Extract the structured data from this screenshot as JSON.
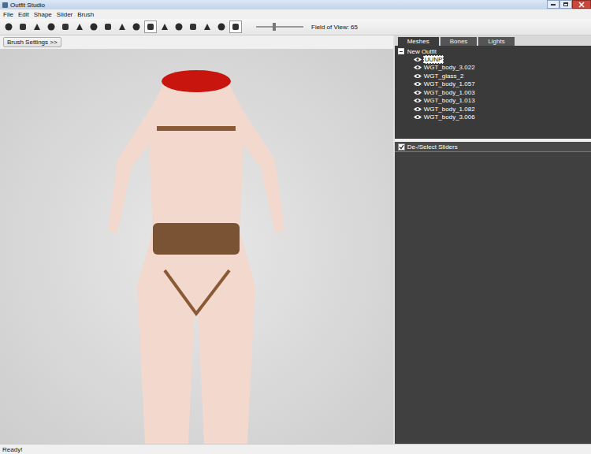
{
  "window": {
    "title": "Outfit Studio"
  },
  "menu": [
    "File",
    "Edit",
    "Shape",
    "Slider",
    "Brush"
  ],
  "tools": [
    {
      "selected": false
    },
    {
      "selected": false
    },
    {
      "selected": false
    },
    {
      "selected": false
    },
    {
      "selected": false
    },
    {
      "selected": false
    },
    {
      "selected": false
    },
    {
      "selected": false
    },
    {
      "selected": false
    },
    {
      "selected": false
    },
    {
      "selected": true
    },
    {
      "selected": false
    },
    {
      "selected": false
    },
    {
      "selected": false
    },
    {
      "selected": false
    },
    {
      "selected": false
    },
    {
      "selected": true
    }
  ],
  "fov": {
    "level": 0.38,
    "label": "Field of View: 65"
  },
  "brush_button": "Brush Settings >>",
  "tabs": [
    {
      "label": "Meshes",
      "selected": true
    },
    {
      "label": "Bones",
      "selected": false
    },
    {
      "label": "Lights",
      "selected": false
    }
  ],
  "tree": {
    "root": "New Outfit",
    "expanded": true,
    "items": [
      {
        "label": "UUNP",
        "selected": true,
        "visible": true
      },
      {
        "label": "WGT_body_3.022",
        "selected": false,
        "visible": true
      },
      {
        "label": "WGT_glass_2",
        "selected": false,
        "visible": true
      },
      {
        "label": "WGT_body_1.057",
        "selected": false,
        "visible": true
      },
      {
        "label": "WGT_body_1.003",
        "selected": false,
        "visible": true
      },
      {
        "label": "WGT_body_1.013",
        "selected": false,
        "visible": true
      },
      {
        "label": "WGT_body_1.082",
        "selected": false,
        "visible": true
      },
      {
        "label": "WGT_body_3.006",
        "selected": false,
        "visible": true
      }
    ]
  },
  "sliders_header": {
    "label": "De-/Select Sliders",
    "checked": true
  },
  "status_bar": "Ready!"
}
